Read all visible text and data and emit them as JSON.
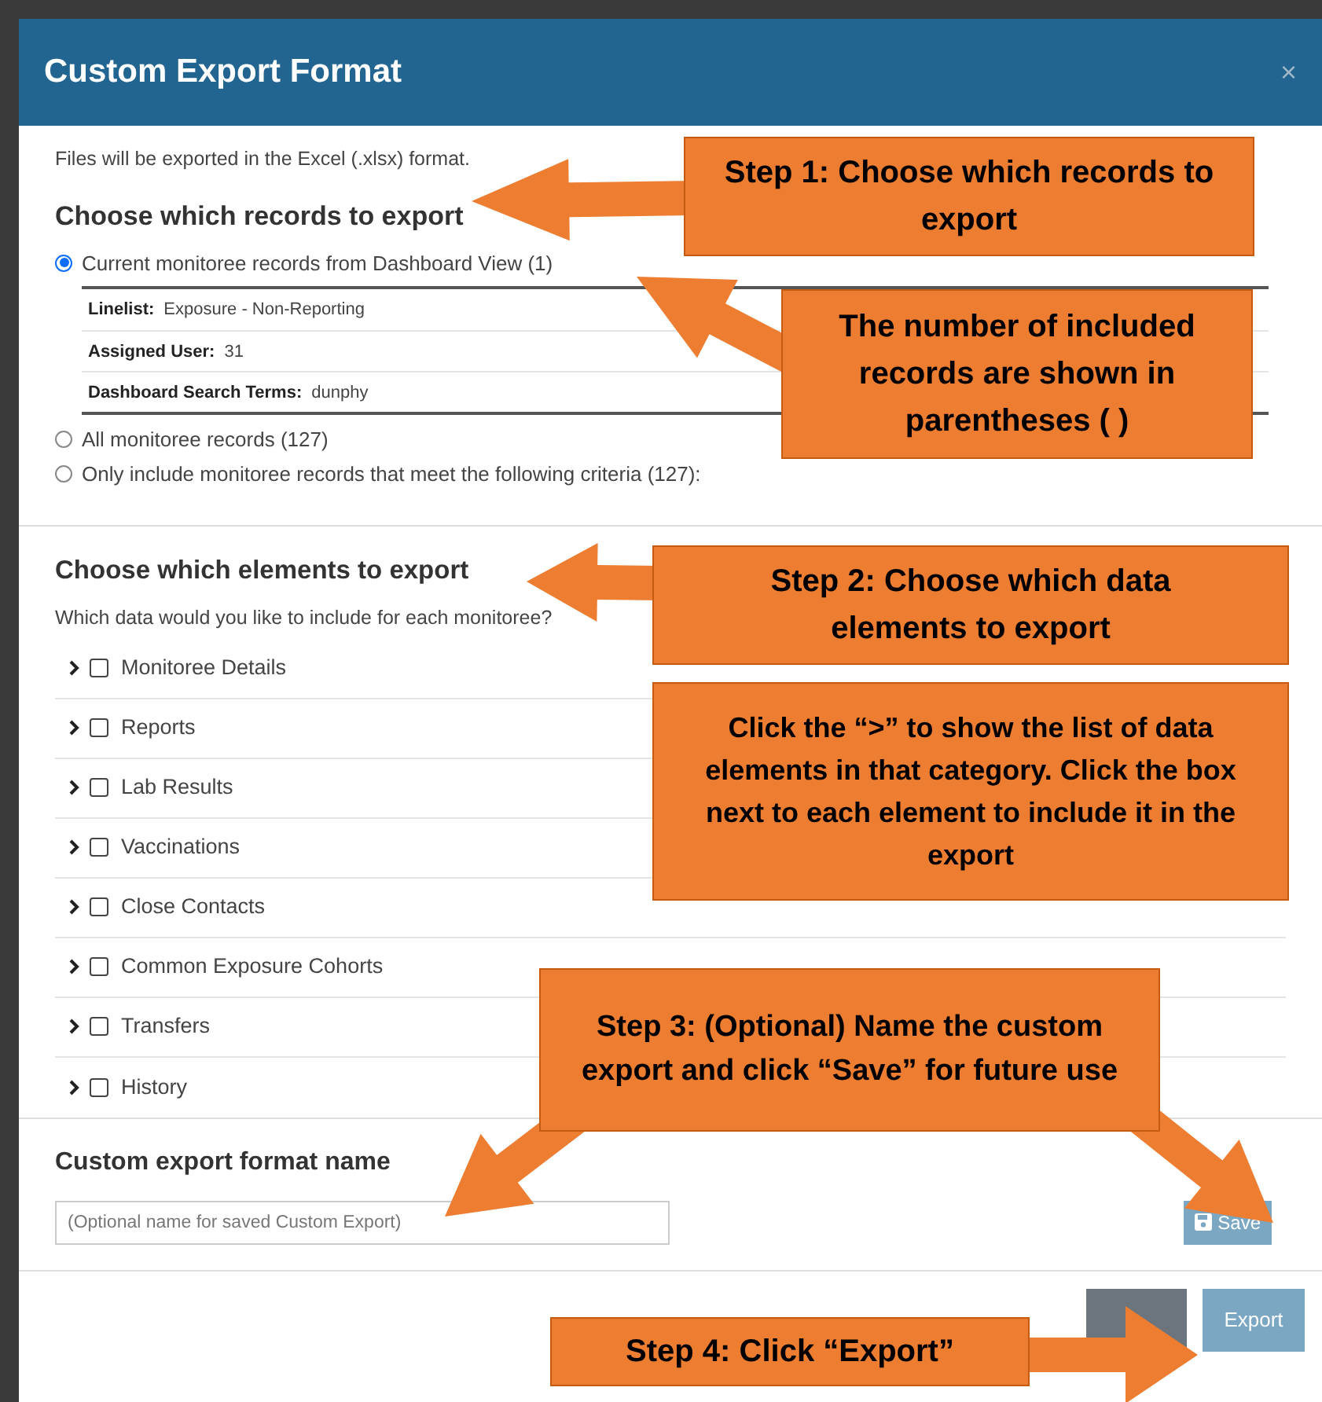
{
  "dialog": {
    "title": "Custom Export Format",
    "close": "×",
    "format_note": "Files will be exported in the Excel (.xlsx) format.",
    "records_section": {
      "heading": "Choose which records to export",
      "options": [
        {
          "label": "Current monitoree records from Dashboard View (1)",
          "selected": true
        },
        {
          "label": "All monitoree records (127)",
          "selected": false
        },
        {
          "label": "Only include monitoree records that meet the following criteria (127):",
          "selected": false
        }
      ],
      "filters": [
        {
          "label": "Linelist:",
          "value": "Exposure - Non-Reporting"
        },
        {
          "label": "Assigned User:",
          "value": "31"
        },
        {
          "label": "Dashboard Search Terms:",
          "value": "dunphy"
        }
      ]
    },
    "elements_section": {
      "heading": "Choose which elements to export",
      "subtitle": "Which data would you like to include for each monitoree?",
      "categories": [
        {
          "label": "Monitoree Details",
          "checked": false,
          "expanded": false
        },
        {
          "label": "Reports",
          "checked": false,
          "expanded": false
        },
        {
          "label": "Lab Results",
          "checked": false,
          "expanded": false
        },
        {
          "label": "Vaccinations",
          "checked": false,
          "expanded": false
        },
        {
          "label": "Close Contacts",
          "checked": false,
          "expanded": false
        },
        {
          "label": "Common Exposure Cohorts",
          "checked": false,
          "expanded": false
        },
        {
          "label": "Transfers",
          "checked": false,
          "expanded": false
        },
        {
          "label": "History",
          "checked": false,
          "expanded": false
        }
      ]
    },
    "name_section": {
      "heading": "Custom export format name",
      "placeholder": "(Optional name for saved Custom Export)",
      "save_label": "Save"
    },
    "footer": {
      "export_label": "Export"
    }
  },
  "callouts": [
    {
      "text": "Step 1: Choose which records to export"
    },
    {
      "text": "The number of included records are shown in parentheses ( )"
    },
    {
      "text": "Step 2: Choose which data elements to export"
    },
    {
      "text": "Click the “>” to show the list of data elements in that category. Click the box next to each element to include it in the export"
    },
    {
      "text": "Step 3: (Optional) Name the custom export and click “Save” for future use"
    },
    {
      "text": "Step 4: Click “Export”"
    }
  ]
}
